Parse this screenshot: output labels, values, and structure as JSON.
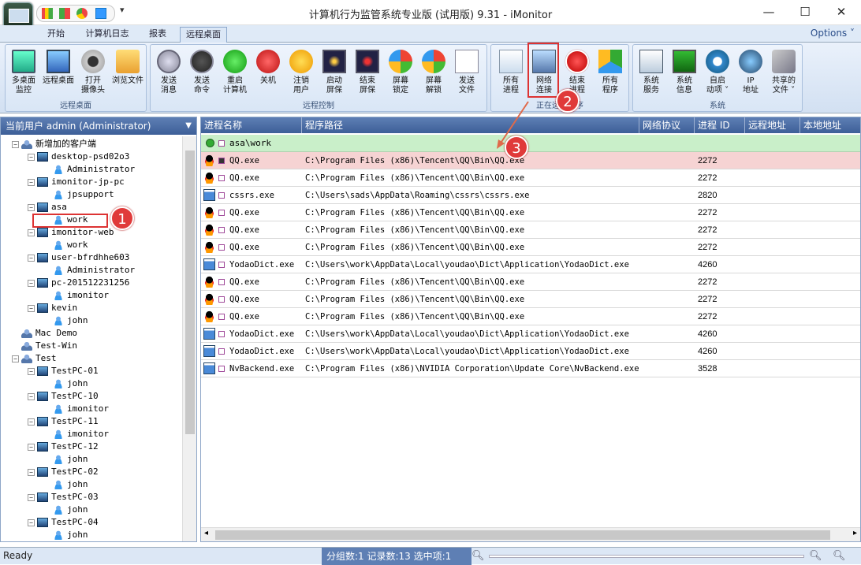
{
  "window": {
    "title": "计算机行为监管系统专业版 (试用版) 9.31 - iMonitor",
    "minimize": "—",
    "maximize": "☐",
    "close": "✕"
  },
  "tabs": [
    {
      "label": "开始"
    },
    {
      "label": "计算机日志"
    },
    {
      "label": "报表"
    },
    {
      "label": "远程桌面"
    }
  ],
  "options_label": "Options ˅",
  "ribbon": {
    "groups": [
      {
        "label": "远程桌面",
        "buttons": [
          {
            "label1": "多桌面",
            "label2": "监控",
            "icon": "multi-monitor-icon"
          },
          {
            "label1": "远程桌面",
            "label2": "",
            "icon": "monitor-icon"
          },
          {
            "label1": "打开",
            "label2": "摄像头",
            "icon": "webcam-icon"
          },
          {
            "label1": "浏览文件",
            "label2": "",
            "icon": "folder-icon"
          }
        ]
      },
      {
        "label": "远程控制",
        "buttons": [
          {
            "label1": "发送",
            "label2": "消息",
            "icon": "message-icon"
          },
          {
            "label1": "发送",
            "label2": "命令",
            "icon": "command-icon"
          },
          {
            "label1": "重启",
            "label2": "计算机",
            "icon": "restart-icon"
          },
          {
            "label1": "关机",
            "label2": "",
            "icon": "power-icon"
          },
          {
            "label1": "注销",
            "label2": "用户",
            "icon": "key-icon"
          },
          {
            "label1": "启动",
            "label2": "屏保",
            "icon": "screensaver-start-icon"
          },
          {
            "label1": "结束",
            "label2": "屏保",
            "icon": "screensaver-stop-icon"
          },
          {
            "label1": "屏幕",
            "label2": "锁定",
            "icon": "screen-lock-icon"
          },
          {
            "label1": "屏幕",
            "label2": "解锁",
            "icon": "screen-unlock-icon"
          },
          {
            "label1": "发送",
            "label2": "文件",
            "icon": "send-file-icon"
          }
        ]
      },
      {
        "label": "正在运行程序",
        "buttons": [
          {
            "label1": "所有",
            "label2": "进程",
            "icon": "process-icon"
          },
          {
            "label1": "网络",
            "label2": "连接",
            "icon": "network-icon"
          },
          {
            "label1": "结束",
            "label2": "进程",
            "icon": "end-process-icon"
          },
          {
            "label1": "所有",
            "label2": "程序",
            "icon": "programs-icon"
          }
        ]
      },
      {
        "label": "系统",
        "buttons": [
          {
            "label1": "系统",
            "label2": "服务",
            "icon": "services-icon"
          },
          {
            "label1": "系统",
            "label2": "信息",
            "icon": "sysinfo-icon"
          },
          {
            "label1": "自启",
            "label2": "动项 ˅",
            "icon": "startup-icon"
          },
          {
            "label1": "IP",
            "label2": "地址",
            "icon": "ip-icon"
          },
          {
            "label1": "共享的",
            "label2": "文件 ˅",
            "icon": "shared-files-icon"
          }
        ]
      }
    ]
  },
  "left_panel": {
    "header": "当前用户 admin (Administrator)",
    "tree": [
      {
        "label": "新增加的客户端",
        "level": 0,
        "type": "group",
        "expand": "−"
      },
      {
        "label": "desktop-psd02o3",
        "level": 1,
        "type": "computer",
        "expand": "−"
      },
      {
        "label": "Administrator",
        "level": 2,
        "type": "user",
        "expand": ""
      },
      {
        "label": "imonitor-jp-pc",
        "level": 1,
        "type": "computer",
        "expand": "−"
      },
      {
        "label": "jpsupport",
        "level": 2,
        "type": "user",
        "expand": ""
      },
      {
        "label": "asa",
        "level": 1,
        "type": "computer",
        "expand": "−"
      },
      {
        "label": "work",
        "level": 2,
        "type": "user",
        "expand": ""
      },
      {
        "label": "imonitor-web",
        "level": 1,
        "type": "computer",
        "expand": "−"
      },
      {
        "label": "work",
        "level": 2,
        "type": "user",
        "expand": ""
      },
      {
        "label": "user-bfrdhhe603",
        "level": 1,
        "type": "computer",
        "expand": "−"
      },
      {
        "label": "Administrator",
        "level": 2,
        "type": "user",
        "expand": ""
      },
      {
        "label": "pc-201512231256",
        "level": 1,
        "type": "computer",
        "expand": "−"
      },
      {
        "label": "imonitor",
        "level": 2,
        "type": "user",
        "expand": ""
      },
      {
        "label": "kevin",
        "level": 1,
        "type": "computer",
        "expand": "−"
      },
      {
        "label": "john",
        "level": 2,
        "type": "user",
        "expand": ""
      },
      {
        "label": "Mac Demo",
        "level": 0,
        "type": "group",
        "expand": ""
      },
      {
        "label": "Test-Win",
        "level": 0,
        "type": "group",
        "expand": ""
      },
      {
        "label": "Test",
        "level": 0,
        "type": "group",
        "expand": "−"
      },
      {
        "label": "TestPC-01",
        "level": 1,
        "type": "computer",
        "expand": "−"
      },
      {
        "label": "john",
        "level": 2,
        "type": "user",
        "expand": ""
      },
      {
        "label": "TestPC-10",
        "level": 1,
        "type": "computer",
        "expand": "−"
      },
      {
        "label": "imonitor",
        "level": 2,
        "type": "user",
        "expand": ""
      },
      {
        "label": "TestPC-11",
        "level": 1,
        "type": "computer",
        "expand": "−"
      },
      {
        "label": "imonitor",
        "level": 2,
        "type": "user",
        "expand": ""
      },
      {
        "label": "TestPC-12",
        "level": 1,
        "type": "computer",
        "expand": "−"
      },
      {
        "label": "john",
        "level": 2,
        "type": "user",
        "expand": ""
      },
      {
        "label": "TestPC-02",
        "level": 1,
        "type": "computer",
        "expand": "−"
      },
      {
        "label": "john",
        "level": 2,
        "type": "user",
        "expand": ""
      },
      {
        "label": "TestPC-03",
        "level": 1,
        "type": "computer",
        "expand": "−"
      },
      {
        "label": "john",
        "level": 2,
        "type": "user",
        "expand": ""
      },
      {
        "label": "TestPC-04",
        "level": 1,
        "type": "computer",
        "expand": "−"
      },
      {
        "label": "john",
        "level": 2,
        "type": "user",
        "expand": ""
      }
    ]
  },
  "grid": {
    "columns": [
      "进程名称",
      "程序路径",
      "网络协议",
      "进程 ID",
      "远程地址",
      "本地地址"
    ],
    "group_label": "asa\\work",
    "rows": [
      {
        "name": "QQ.exe",
        "path": "C:\\Program Files (x86)\\Tencent\\QQ\\Bin\\QQ.exe",
        "pid": "2272",
        "icon": "qq-penguin-icon",
        "selected": true
      },
      {
        "name": "QQ.exe",
        "path": "C:\\Program Files (x86)\\Tencent\\QQ\\Bin\\QQ.exe",
        "pid": "2272",
        "icon": "qq-penguin-icon"
      },
      {
        "name": "cssrs.exe",
        "path": "C:\\Users\\sads\\AppData\\Roaming\\cssrs\\cssrs.exe",
        "pid": "2820",
        "icon": "app-window-icon"
      },
      {
        "name": "QQ.exe",
        "path": "C:\\Program Files (x86)\\Tencent\\QQ\\Bin\\QQ.exe",
        "pid": "2272",
        "icon": "qq-penguin-icon"
      },
      {
        "name": "QQ.exe",
        "path": "C:\\Program Files (x86)\\Tencent\\QQ\\Bin\\QQ.exe",
        "pid": "2272",
        "icon": "qq-penguin-icon"
      },
      {
        "name": "QQ.exe",
        "path": "C:\\Program Files (x86)\\Tencent\\QQ\\Bin\\QQ.exe",
        "pid": "2272",
        "icon": "qq-penguin-icon"
      },
      {
        "name": "YodaoDict.exe",
        "path": "C:\\Users\\work\\AppData\\Local\\youdao\\Dict\\Application\\YodaoDict.exe",
        "pid": "4260",
        "icon": "app-window-icon"
      },
      {
        "name": "QQ.exe",
        "path": "C:\\Program Files (x86)\\Tencent\\QQ\\Bin\\QQ.exe",
        "pid": "2272",
        "icon": "qq-penguin-icon"
      },
      {
        "name": "QQ.exe",
        "path": "C:\\Program Files (x86)\\Tencent\\QQ\\Bin\\QQ.exe",
        "pid": "2272",
        "icon": "qq-penguin-icon"
      },
      {
        "name": "QQ.exe",
        "path": "C:\\Program Files (x86)\\Tencent\\QQ\\Bin\\QQ.exe",
        "pid": "2272",
        "icon": "qq-penguin-icon"
      },
      {
        "name": "YodaoDict.exe",
        "path": "C:\\Users\\work\\AppData\\Local\\youdao\\Dict\\Application\\YodaoDict.exe",
        "pid": "4260",
        "icon": "app-window-icon"
      },
      {
        "name": "YodaoDict.exe",
        "path": "C:\\Users\\work\\AppData\\Local\\youdao\\Dict\\Application\\YodaoDict.exe",
        "pid": "4260",
        "icon": "app-window-icon"
      },
      {
        "name": "NvBackend.exe",
        "path": "C:\\Program Files (x86)\\NVIDIA Corporation\\Update Core\\NvBackend.exe",
        "pid": "3528",
        "icon": "app-window-icon"
      }
    ]
  },
  "status": {
    "ready": "Ready",
    "counts": "分组数:1  记录数:13  选中项:1"
  },
  "annotations": [
    "1",
    "2",
    "3"
  ],
  "colors": {
    "header_blue": "#4a6ca6",
    "selected_row": "#f6d3d3",
    "group_row": "#c9efc9",
    "annotation_red": "#e03a3a"
  }
}
